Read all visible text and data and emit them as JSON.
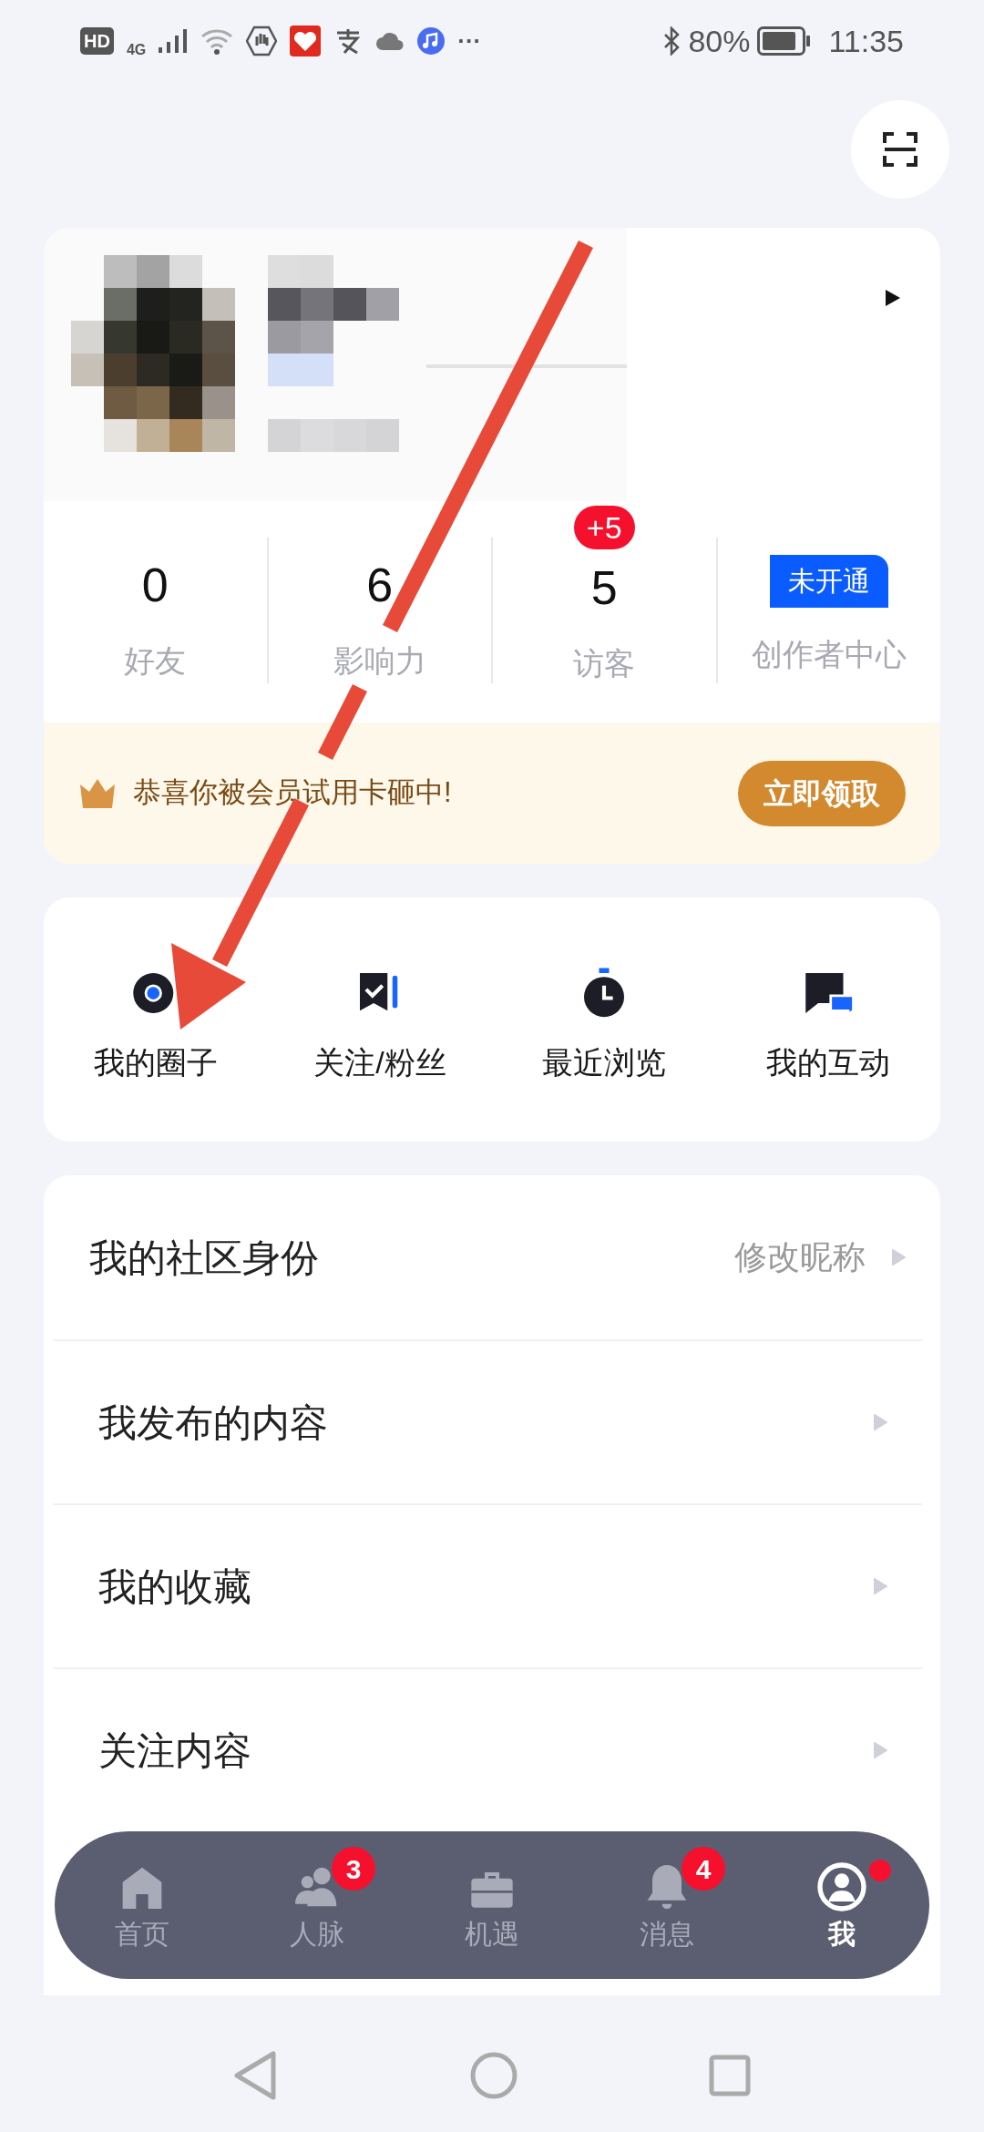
{
  "status_bar": {
    "hd": "HD",
    "network": "4G",
    "more": "···",
    "battery": "80%",
    "time": "11:35"
  },
  "stats": [
    {
      "value": "0",
      "label": "好友"
    },
    {
      "value": "6",
      "label": "影响力"
    },
    {
      "value": "5",
      "label": "访客",
      "badge": "+5"
    },
    {
      "tag": "未开通",
      "label": "创作者中心"
    }
  ],
  "banner": {
    "text": "恭喜你被会员试用卡砸中!",
    "button": "立即领取"
  },
  "quick_actions": [
    {
      "label": "我的圈子"
    },
    {
      "label": "关注/粉丝"
    },
    {
      "label": "最近浏览"
    },
    {
      "label": "我的互动"
    }
  ],
  "menu": [
    {
      "label": "我的社区身份",
      "hint": "修改昵称"
    },
    {
      "label": "我发布的内容"
    },
    {
      "label": "我的收藏"
    },
    {
      "label": "关注内容"
    }
  ],
  "tab_bar": [
    {
      "label": "首页",
      "selected": false
    },
    {
      "label": "人脉",
      "selected": false,
      "badge": "3"
    },
    {
      "label": "机遇",
      "selected": false
    },
    {
      "label": "消息",
      "selected": false,
      "badge": "4"
    },
    {
      "label": "我",
      "selected": true,
      "dot": true
    }
  ]
}
